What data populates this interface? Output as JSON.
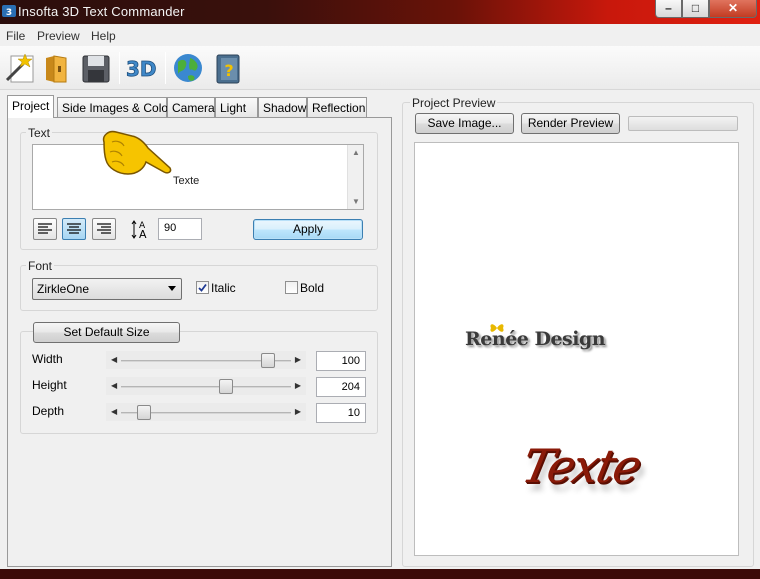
{
  "window": {
    "title": "Insofta 3D Text Commander",
    "controls": {
      "minimize": "–",
      "maximize": "□",
      "close": "✕"
    }
  },
  "menu": [
    "File",
    "Preview",
    "Help"
  ],
  "toolbar": {
    "buttons": [
      "new-wand-icon",
      "open-folder-icon",
      "save-disk-icon",
      "3d-logo-icon",
      "globe-icon",
      "help-book-icon"
    ]
  },
  "tabs": [
    "Project",
    "Side Images & Colors",
    "Camera",
    "Light",
    "Shadow",
    "Reflection"
  ],
  "active_tab": "Project",
  "text_group": {
    "label": "Text",
    "value": "Texte",
    "font_size": "90",
    "apply_label": "Apply"
  },
  "font_group": {
    "label": "Font",
    "font_name": "ZirkleOne",
    "italic_label": "Italic",
    "italic_checked": true,
    "bold_label": "Bold",
    "bold_checked": false
  },
  "size_group": {
    "default_button": "Set Default Size",
    "width_label": "Width",
    "width_value": "100",
    "height_label": "Height",
    "height_value": "204",
    "depth_label": "Depth",
    "depth_value": "10",
    "width_fraction": 0.9,
    "height_fraction": 0.63,
    "depth_fraction": 0.1
  },
  "preview": {
    "label": "Project Preview",
    "save_button": "Save Image...",
    "render_button": "Render Preview",
    "watermark": "Renée Design",
    "preview_text": "Texte"
  },
  "colors": {
    "preview_text": "#8a1a08",
    "titlebar_accent": "#e02010"
  }
}
